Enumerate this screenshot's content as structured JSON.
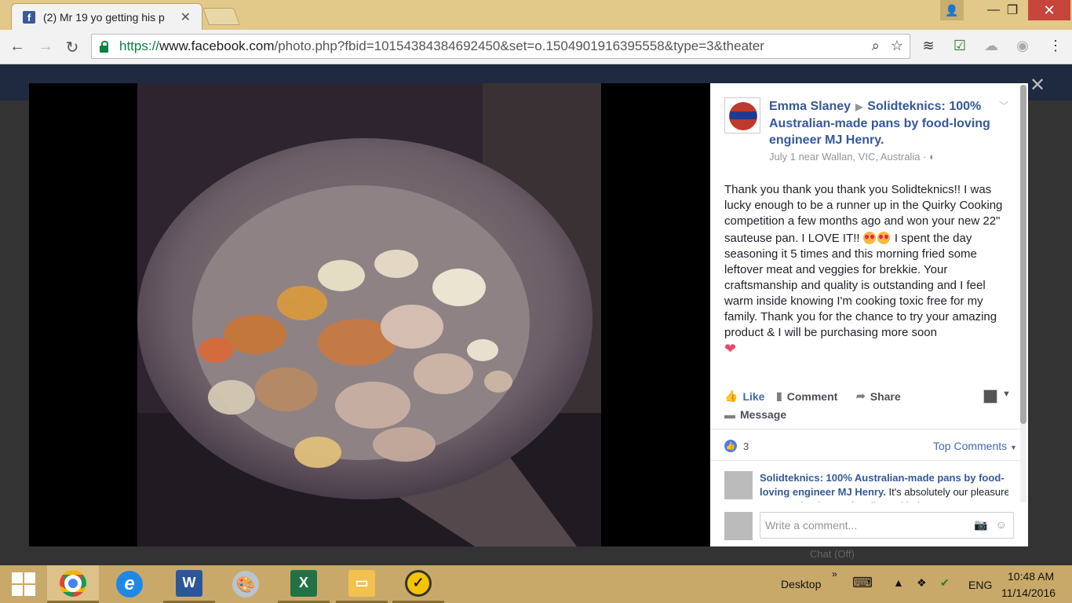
{
  "browser": {
    "tab_title": "(2) Mr 19 yo getting his p",
    "url_scheme": "https://",
    "url_host": "www.facebook.com",
    "url_path": "/photo.php?fbid=10154384384692450&set=o.1504901916395558&type=3&theater"
  },
  "post": {
    "author": "Emma Slaney",
    "page": "Solidteknics: 100% Australian-made pans by food-loving engineer MJ Henry.",
    "meta": "July 1 near Wallan, VIC, Australia",
    "text_1": "Thank you thank you thank you Solidteknics!! I was lucky enough to be a runner up in the Quirky Cooking competition a few months ago and won your new 22\" sauteuse pan. I LOVE IT!! ",
    "text_2": " I spent the day seasoning it 5 times and this morning fried some leftover meat and veggies for brekkie. Your craftsmanship and quality is outstanding and I feel warm inside knowing I'm cooking toxic free for my family. Thank you for the chance to try your amazing product & I will be purchasing more soon"
  },
  "actions": {
    "like": "Like",
    "comment": "Comment",
    "share": "Share",
    "message": "Message"
  },
  "reactions": {
    "count": "3",
    "sort_label": "Top Comments"
  },
  "comment": {
    "author": "Solidteknics: 100% Australian-made pans by food-loving engineer MJ Henry.",
    "text": " It's absolutely our pleasure Emma. Thank YOU for all your kind"
  },
  "composer": {
    "placeholder": "Write a comment..."
  },
  "facebook": {
    "chat_status": "Chat (Off)"
  },
  "taskbar": {
    "desktop_label": "Desktop",
    "language": "ENG",
    "time": "10:48 AM",
    "date": "11/14/2016"
  }
}
